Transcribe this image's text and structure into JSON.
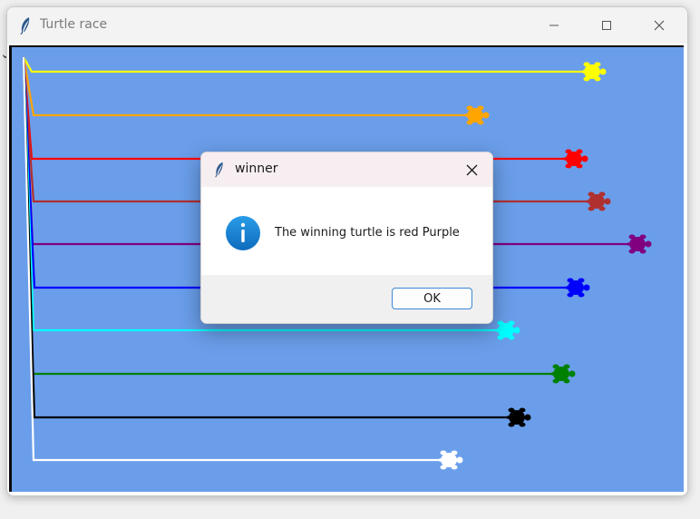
{
  "window": {
    "title": "Turtle race",
    "icon": "feather-icon",
    "controls": [
      "minimize-icon",
      "maximize-icon",
      "close-icon"
    ]
  },
  "race": {
    "background_color": "#6a9eea",
    "turtles": [
      {
        "color": "#ffff00"
      },
      {
        "color": "#ffa500"
      },
      {
        "color": "#ff0000"
      },
      {
        "color": "#b03030"
      },
      {
        "color": "#800080"
      },
      {
        "color": "#0000ff"
      },
      {
        "color": "#00ffff"
      },
      {
        "color": "#008000"
      },
      {
        "color": "#000000"
      },
      {
        "color": "#ffffff"
      }
    ]
  },
  "dialog": {
    "title": "winner",
    "icon": "info-icon",
    "message": "The winning turtle is red Purple",
    "ok_label": "OK"
  }
}
